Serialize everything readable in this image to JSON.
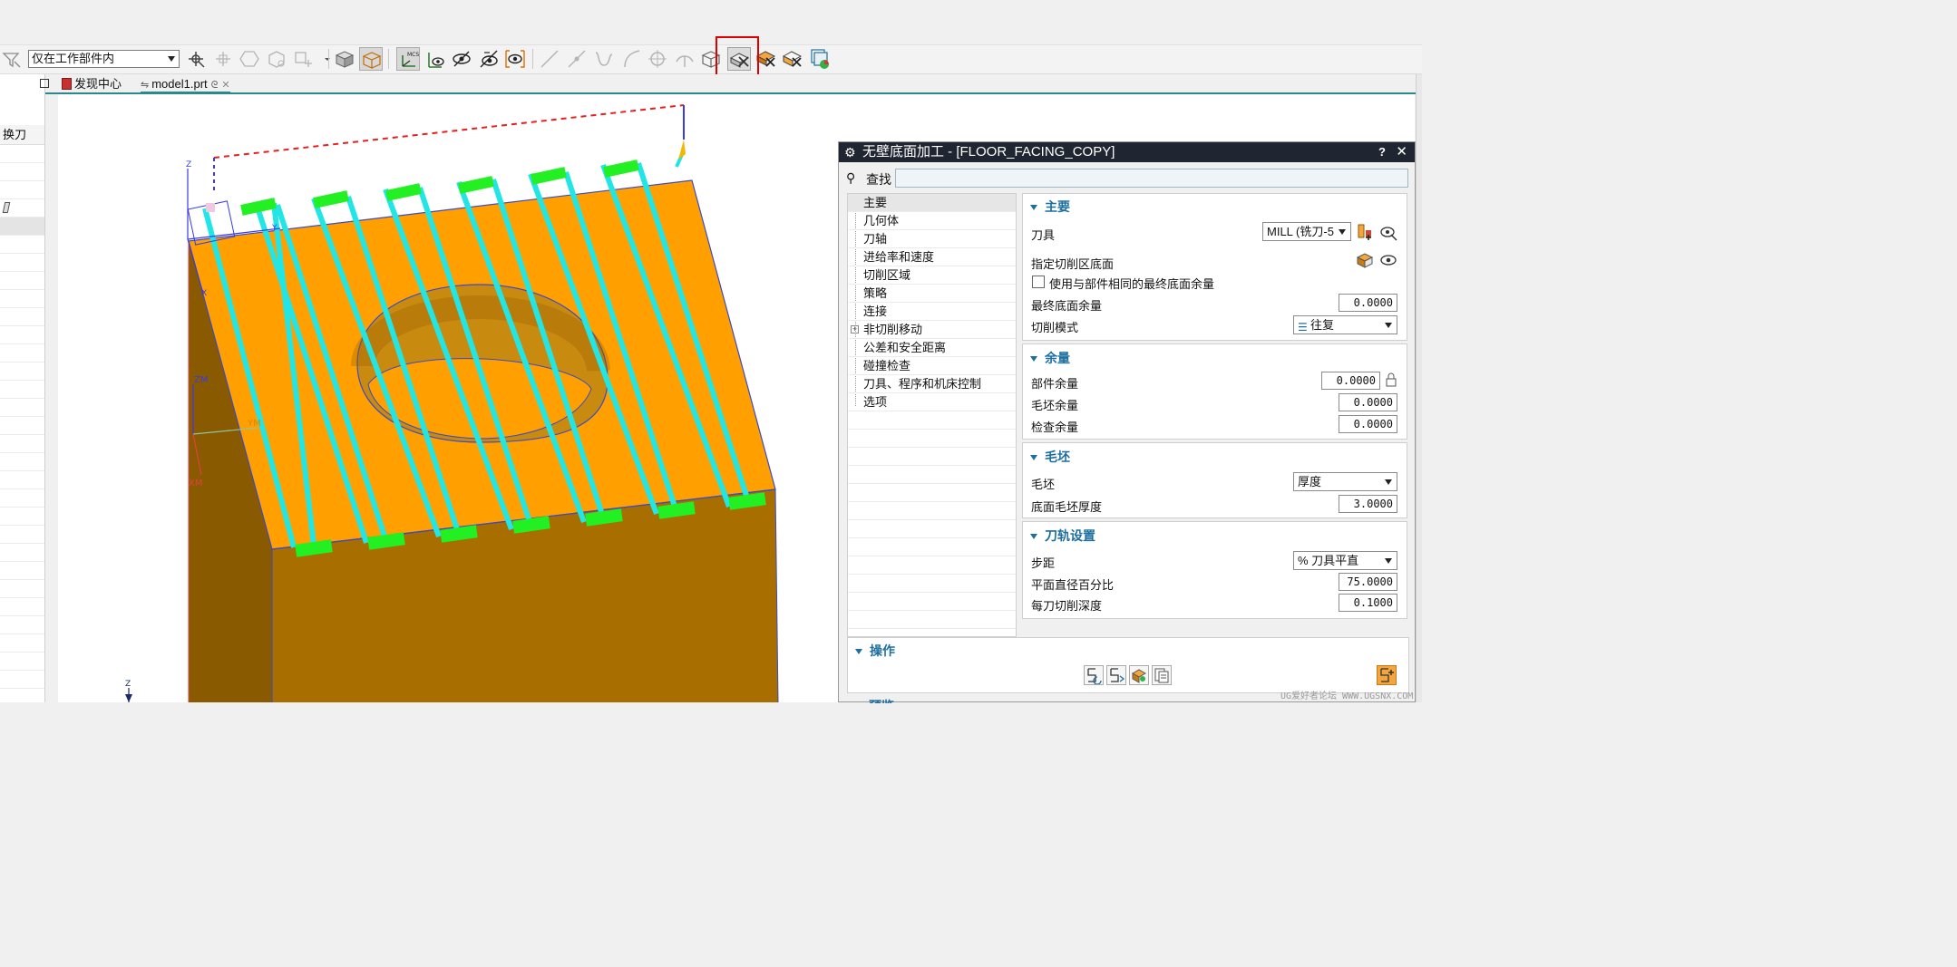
{
  "toolbar": {
    "filter_select_value": "仅在工作部件内",
    "mcs_label": "MCS"
  },
  "left_panel": {
    "header": "换刀"
  },
  "tabs": [
    {
      "label": "发现中心",
      "closable": false
    },
    {
      "label": "model1.prt",
      "closable": true
    }
  ],
  "viewport": {
    "axis_labels": {
      "z_top": "Z",
      "y_top": "Y",
      "x_top": "X",
      "zm": "ZM",
      "ym": "YM",
      "xm": "XM",
      "z_bottom": "Z"
    },
    "colors": {
      "part_top": "#ffa000",
      "part_side": "#a86e00",
      "toolpath": "#22e6e6",
      "step": "#22f022",
      "rapid": "#e62020",
      "edge": "#3a4ac8"
    }
  },
  "dialog": {
    "title": "无壁底面加工 - [FLOOR_FACING_COPY]",
    "help": "?",
    "close": "✕",
    "find_label": "查找",
    "nav": [
      {
        "label": "主要",
        "selected": true,
        "expandable": false
      },
      {
        "label": "几何体",
        "selected": false,
        "expandable": false
      },
      {
        "label": "刀轴",
        "selected": false,
        "expandable": false
      },
      {
        "label": "进给率和速度",
        "selected": false,
        "expandable": false
      },
      {
        "label": "切削区域",
        "selected": false,
        "expandable": false
      },
      {
        "label": "策略",
        "selected": false,
        "expandable": false
      },
      {
        "label": "连接",
        "selected": false,
        "expandable": false
      },
      {
        "label": "非切削移动",
        "selected": false,
        "expandable": true
      },
      {
        "label": "公差和安全距离",
        "selected": false,
        "expandable": false
      },
      {
        "label": "碰撞检查",
        "selected": false,
        "expandable": false
      },
      {
        "label": "刀具、程序和机床控制",
        "selected": false,
        "expandable": false
      },
      {
        "label": "选项",
        "selected": false,
        "expandable": false
      }
    ],
    "main": {
      "header": "主要",
      "tool_label": "刀具",
      "tool_value": "MILL (铣刀-5",
      "floor_label": "指定切削区底面",
      "same_floor_stock_label": "使用与部件相同的最终底面余量",
      "final_floor_stock_label": "最终底面余量",
      "final_floor_stock_value": "0.0000",
      "cut_pattern_label": "切削模式",
      "cut_pattern_value": "往复"
    },
    "stock": {
      "header": "余量",
      "part_stock_label": "部件余量",
      "part_stock_value": "0.0000",
      "blank_stock_label": "毛坯余量",
      "blank_stock_value": "0.0000",
      "check_stock_label": "检查余量",
      "check_stock_value": "0.0000"
    },
    "blank": {
      "header": "毛坯",
      "blank_label": "毛坯",
      "blank_value": "厚度",
      "floor_blank_thickness_label": "底面毛坯厚度",
      "floor_blank_thickness_value": "3.0000"
    },
    "path": {
      "header": "刀轨设置",
      "stepover_label": "步距",
      "stepover_value": "% 刀具平直",
      "percent_flat_label": "平面直径百分比",
      "percent_flat_value": "75.0000",
      "depth_per_cut_label": "每刀切削深度",
      "depth_per_cut_value": "0.1000"
    },
    "ops": {
      "header": "操作"
    },
    "next_section": "预览"
  },
  "watermark": "UG爱好者论坛 WWW.UGSNX.COM"
}
